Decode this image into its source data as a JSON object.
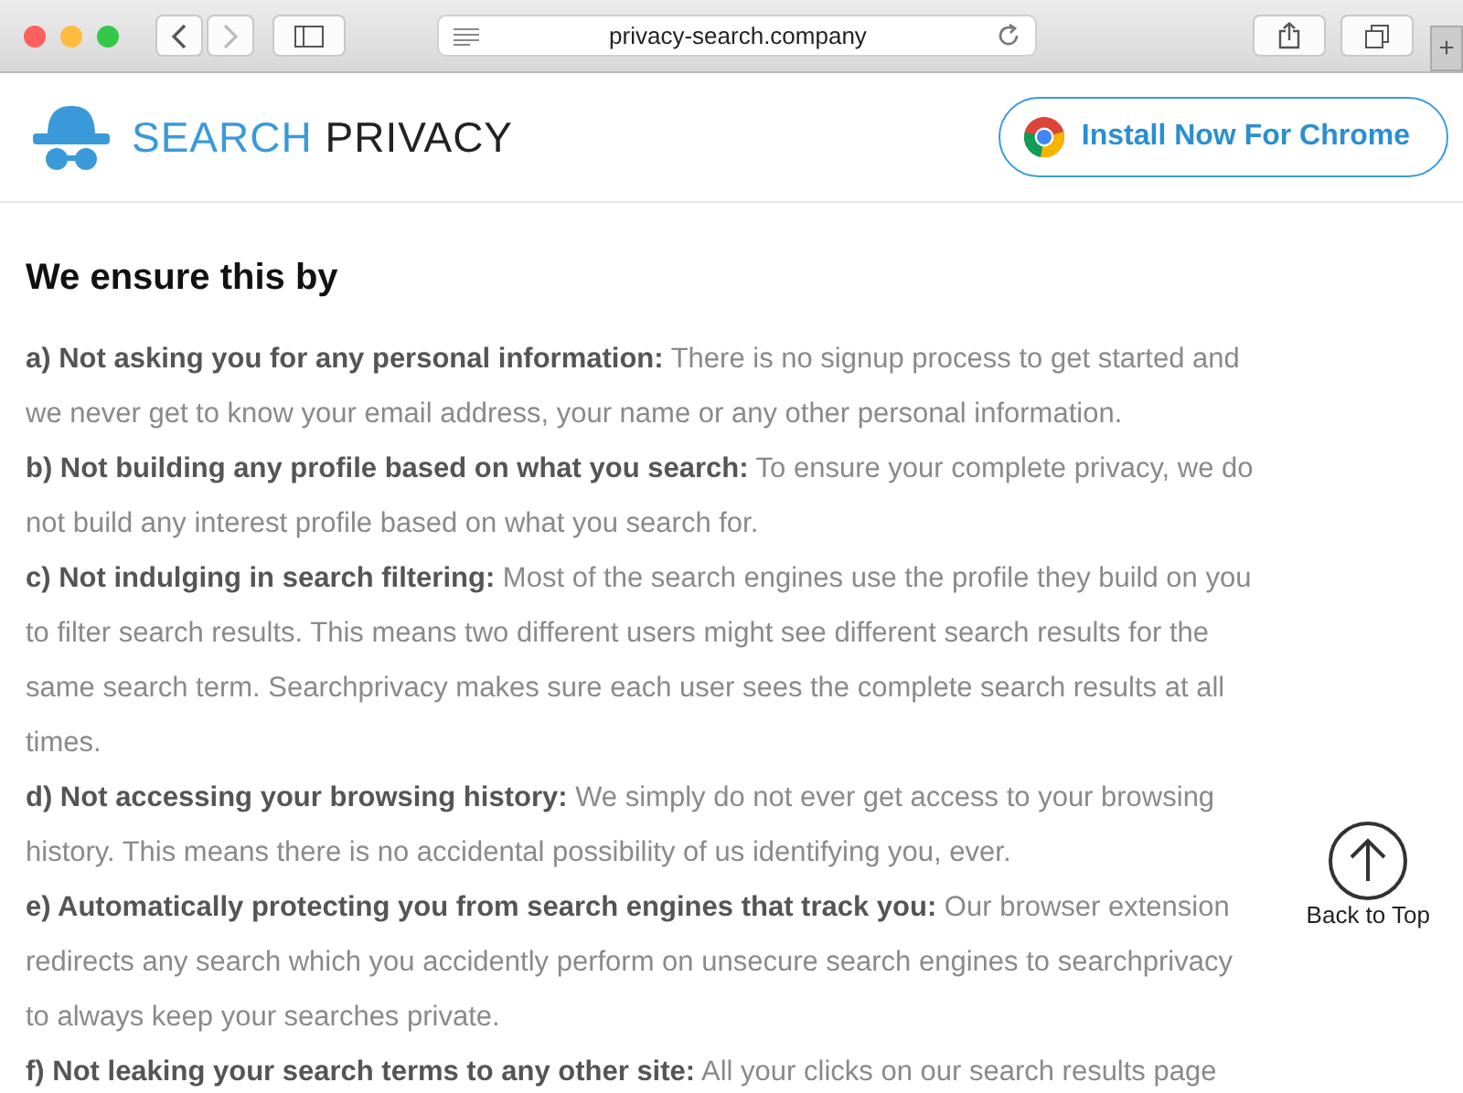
{
  "browser": {
    "url": "privacy-search.company",
    "new_tab": "+"
  },
  "header": {
    "logo_first": "SEARCH",
    "logo_second": "PRIVACY",
    "install_button": "Install Now For Chrome"
  },
  "heading": "We ensure this by",
  "items": [
    {
      "lead": "a) Not asking you for any personal information:",
      "body": "There is no signup process to get started and we never get to know your email address, your name or any other personal information."
    },
    {
      "lead": "b) Not building any profile based on what you search:",
      "body": "To ensure your complete privacy, we do not build any interest profile based on what you search for."
    },
    {
      "lead": "c) Not indulging in search filtering:",
      "body": "Most of the search engines use the profile they build on you to filter search results. This means two different users might see different search results for the same search term. Searchprivacy makes sure each user sees the complete search results at all times."
    },
    {
      "lead": "d) Not accessing your browsing history:",
      "body": "We simply do not ever get access to your browsing history. This means there is no accidental possibility of us identifying you, ever."
    },
    {
      "lead": "e) Automatically protecting you from search engines that track you:",
      "body": "Our browser extension redirects any search which you accidently perform on unsecure search engines to searchprivacy to always keep your searches private."
    },
    {
      "lead": "f) Not leaking your search terms to any other site:",
      "body": "All your clicks on our search results page"
    }
  ],
  "back_to_top": {
    "label": "Back to Top"
  }
}
